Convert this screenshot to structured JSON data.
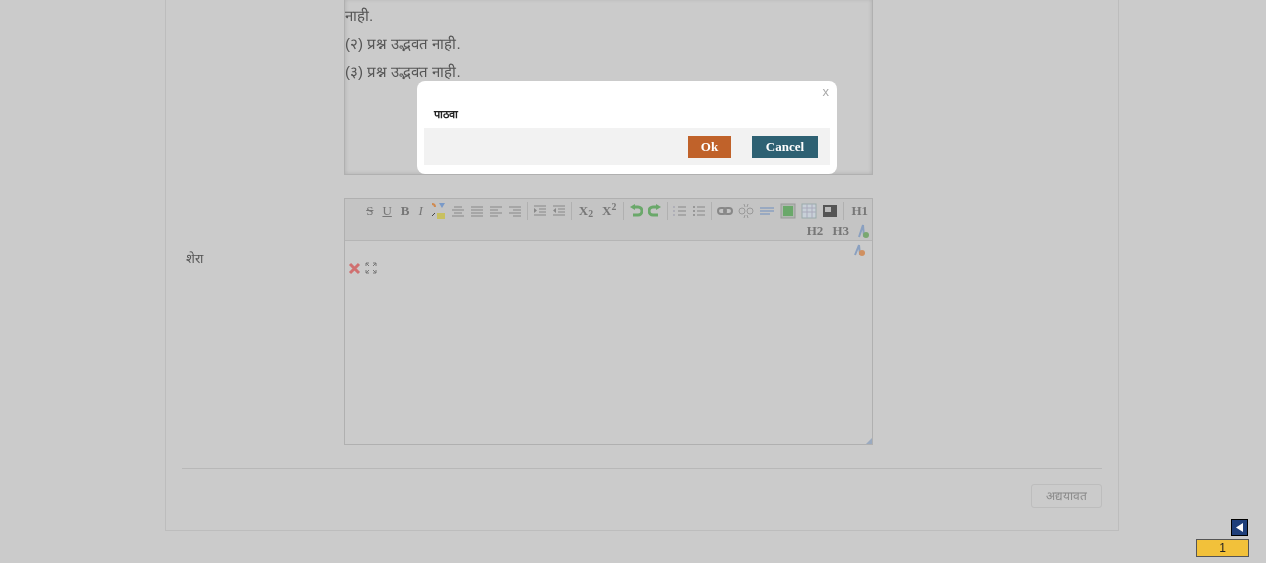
{
  "answer_text": [
    "नाही.",
    "(२) प्रश्न उद्भवत नाही.",
    "(३) प्रश्न उद्भवत नाही."
  ],
  "remark_label": "शेरा",
  "toolbar": {
    "format_buttons": [
      "S",
      "U",
      "B",
      "I"
    ],
    "script_buttons": [
      "X$_{2}$",
      "X$^{2}$"
    ],
    "heading_buttons": [
      "H1",
      "H2",
      "H3"
    ]
  },
  "update_button": {
    "label": "अद्ययावत",
    "disabled": true
  },
  "page_indicator": "1",
  "dialog": {
    "close": "x",
    "message": "पाठवा",
    "buttons": [
      {
        "label": "Ok",
        "kind": "primary"
      },
      {
        "label": "Cancel",
        "kind": "secondary"
      }
    ]
  }
}
